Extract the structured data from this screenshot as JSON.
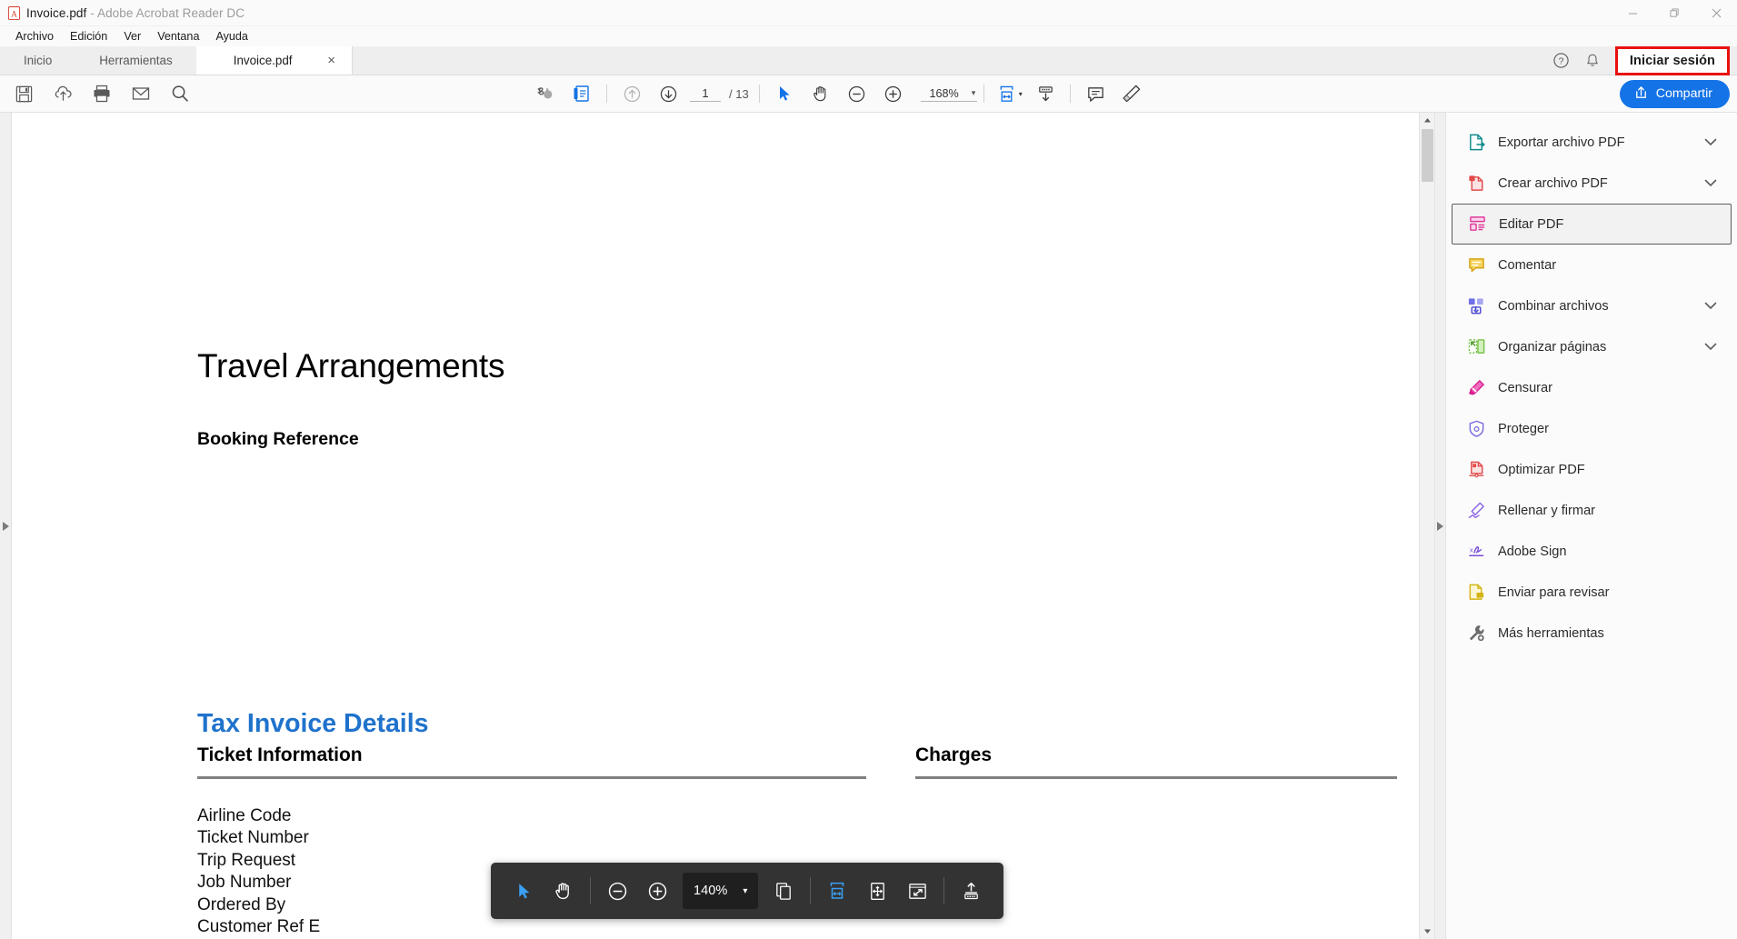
{
  "window": {
    "title": "Invoice.pdf",
    "title_suffix": " - Adobe Acrobat Reader DC",
    "minimize": "—",
    "restore": "❐",
    "close": "✕"
  },
  "menubar": {
    "items": [
      "Archivo",
      "Edición",
      "Ver",
      "Ventana",
      "Ayuda"
    ]
  },
  "tabbar": {
    "nav_tabs": [
      "Inicio",
      "Herramientas"
    ],
    "document_tab": {
      "label": "Invoice.pdf",
      "close": "×"
    },
    "help_title": "Ayuda",
    "notifications_title": "Notificaciones",
    "signin_label": "Iniciar sesión"
  },
  "toolbar": {
    "left_icons": [
      "save-icon",
      "cloud-upload-icon",
      "print-icon",
      "email-icon",
      "search-icon"
    ],
    "sign_icon": "add-signature-icon",
    "thumbnail_icon": "page-thumbnail-icon",
    "prev_page_label": "Página anterior",
    "next_page_label": "Página siguiente",
    "page_current": "1",
    "page_total": "/ 13",
    "select_tool": "select-cursor-icon",
    "hand_tool": "hand-tool-icon",
    "zoom_out": "zoom-out-icon",
    "zoom_in": "zoom-in-icon",
    "zoom_value": "168%",
    "zoom_caret": "▾",
    "fit_width_icon": "fit-width-icon",
    "fit_caret": "▾",
    "scroll_mode_icon": "scroll-mode-icon",
    "comment_icon": "comment-icon",
    "highlight_icon": "highlight-icon",
    "share_label": "Compartir",
    "share_icon": "share-upload-icon",
    "share_color": "#1473e6"
  },
  "document": {
    "title": "Travel Arrangements",
    "booking_reference": "Booking Reference",
    "tax_invoice_heading": "Tax Invoice Details",
    "tax_invoice_color": "#1f72cc",
    "ticket_information": "Ticket Information",
    "charges": "Charges",
    "fields": [
      "Airline Code",
      "Ticket Number",
      "Trip Request",
      "Job Number",
      "Ordered By"
    ],
    "field_clipped": "Customer Ref E"
  },
  "sidebar": {
    "items": [
      {
        "label": "Exportar archivo PDF",
        "icon": "export-pdf-icon",
        "color": "#0f8a8a",
        "expandable": true,
        "selected": false
      },
      {
        "label": "Crear archivo PDF",
        "icon": "create-pdf-icon",
        "color": "#e34a4a",
        "expandable": true,
        "selected": false
      },
      {
        "label": "Editar PDF",
        "icon": "edit-pdf-icon",
        "color": "#e0399a",
        "expandable": false,
        "selected": true
      },
      {
        "label": "Comentar",
        "icon": "comment-icon",
        "color": "#e8b61f",
        "expandable": false,
        "selected": false
      },
      {
        "label": "Combinar archivos",
        "icon": "combine-files-icon",
        "color": "#5a5adb",
        "expandable": true,
        "selected": false
      },
      {
        "label": "Organizar páginas",
        "icon": "organize-pages-icon",
        "color": "#6fbf3f",
        "expandable": true,
        "selected": false
      },
      {
        "label": "Censurar",
        "icon": "redact-icon",
        "color": "#d81b8c",
        "expandable": false,
        "selected": false
      },
      {
        "label": "Proteger",
        "icon": "protect-shield-icon",
        "color": "#7b6fe0",
        "expandable": false,
        "selected": false
      },
      {
        "label": "Optimizar PDF",
        "icon": "optimize-pdf-icon",
        "color": "#e34a4a",
        "expandable": false,
        "selected": false
      },
      {
        "label": "Rellenar y firmar",
        "icon": "fill-and-sign-icon",
        "color": "#8b63e8",
        "expandable": false,
        "selected": false
      },
      {
        "label": "Adobe Sign",
        "icon": "adobe-sign-icon",
        "color": "#7b4fd8",
        "expandable": false,
        "selected": false
      },
      {
        "label": "Enviar para revisar",
        "icon": "send-for-review-icon",
        "color": "#d4b516",
        "expandable": false,
        "selected": false
      },
      {
        "label": "Más herramientas",
        "icon": "more-tools-wrench-icon",
        "color": "#6b6b6b",
        "expandable": false,
        "selected": false
      }
    ],
    "chevron": "⌄"
  },
  "float_toolbar": {
    "select_tool": "select-cursor-icon",
    "hand_tool": "hand-tool-icon",
    "zoom_out": "zoom-out-icon",
    "zoom_in": "zoom-in-icon",
    "zoom_value": "140%",
    "zoom_caret": "▾",
    "page_view_icon": "page-display-icon",
    "fit_width_icon": "fit-width-icon",
    "fit_page_icon": "fit-page-icon",
    "fullscreen_icon": "fullscreen-icon",
    "scroll_mode_icon": "scroll-mode-icon"
  },
  "panel_handles": {
    "left_arrow": "▶",
    "right_arrow": "▶"
  }
}
